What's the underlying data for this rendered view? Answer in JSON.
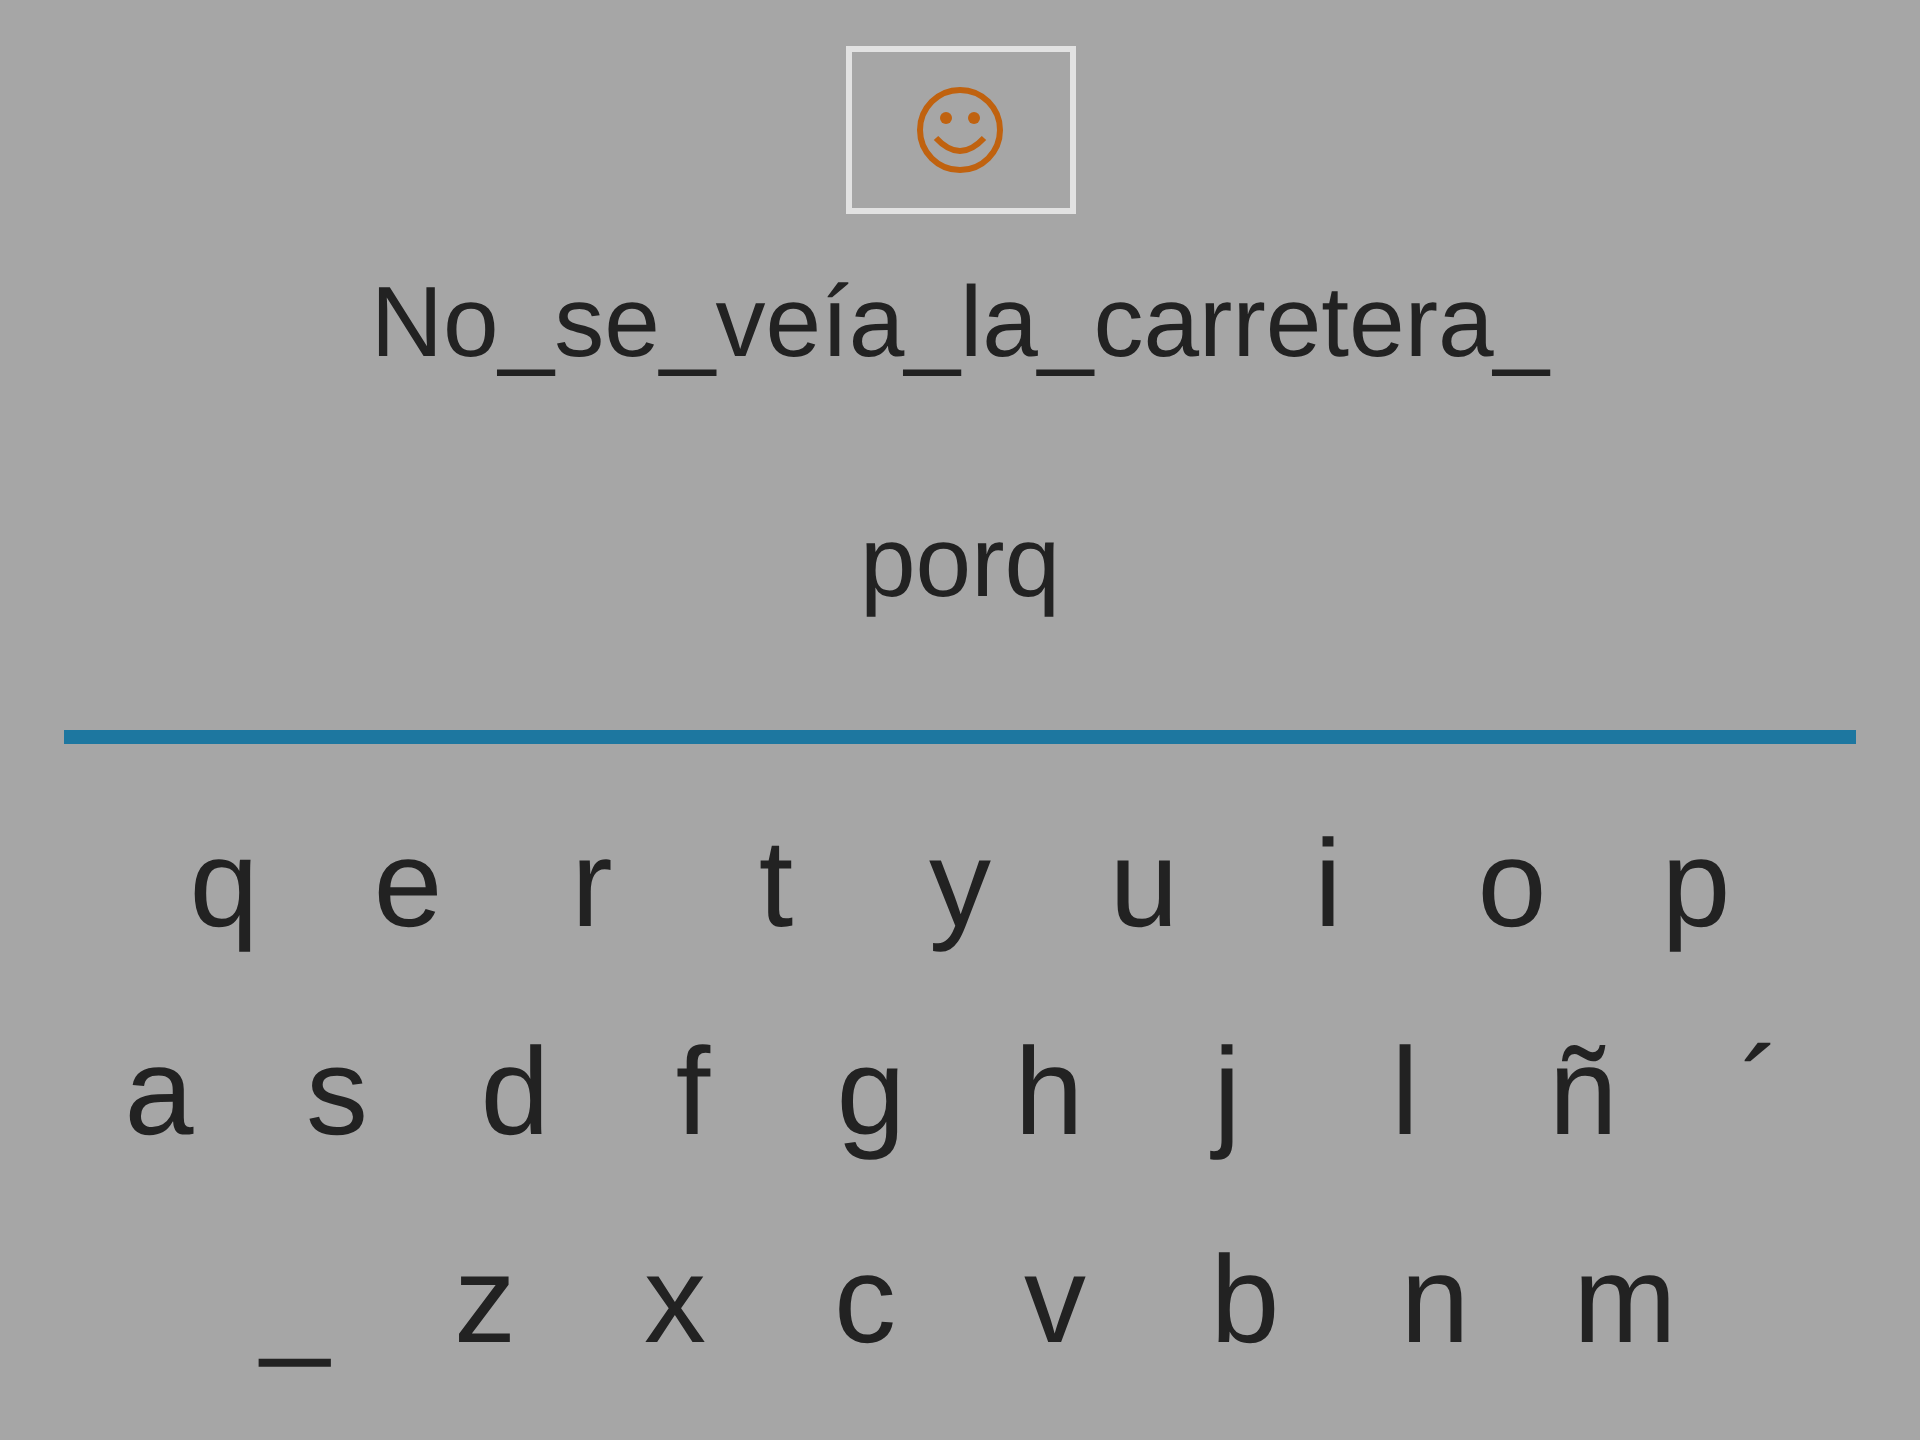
{
  "sentence": "No_se_veía_la_carretera_",
  "typed": "porq",
  "keyboard": [
    [
      "q",
      "e",
      "r",
      "t",
      "y",
      "u",
      "i",
      "o",
      "p"
    ],
    [
      "a",
      "s",
      "d",
      "f",
      "g",
      "h",
      "j",
      "l",
      "ñ",
      "´"
    ],
    [
      "_",
      "z",
      "x",
      "c",
      "v",
      "b",
      "n",
      "m"
    ]
  ]
}
